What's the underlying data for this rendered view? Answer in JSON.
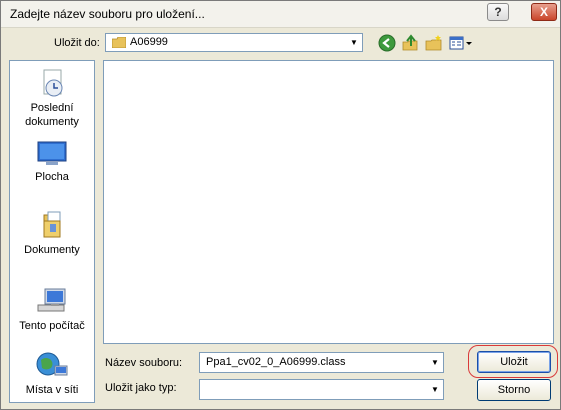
{
  "window": {
    "title": "Zadejte název souboru pro uložení...",
    "help_glyph": "?",
    "close_glyph": "X"
  },
  "lookin": {
    "label": "Uložit do:",
    "value": "A06999"
  },
  "toolbar": {
    "icons": [
      "back-icon",
      "up-folder-icon",
      "new-folder-icon",
      "views-menu-icon"
    ]
  },
  "sidebar": {
    "items": [
      {
        "label": "Poslední dokumenty",
        "icon": "recent-documents-icon"
      },
      {
        "label": "Plocha",
        "icon": "desktop-icon"
      },
      {
        "label": "Dokumenty",
        "icon": "my-documents-icon"
      },
      {
        "label": "Tento počítač",
        "icon": "my-computer-icon"
      },
      {
        "label": "Místa v síti",
        "icon": "network-places-icon"
      }
    ]
  },
  "form": {
    "filename_label": "Název souboru:",
    "filename_value": "Ppa1_cv02_0_A06999.class",
    "filetype_label": "Uložit jako typ:",
    "filetype_value": ""
  },
  "buttons": {
    "save": "Uložit",
    "cancel": "Storno"
  },
  "colors": {
    "dialog_bg": "#ece9d8",
    "highlight_ring": "#d93a3a",
    "combo_border": "#7f9db9"
  }
}
